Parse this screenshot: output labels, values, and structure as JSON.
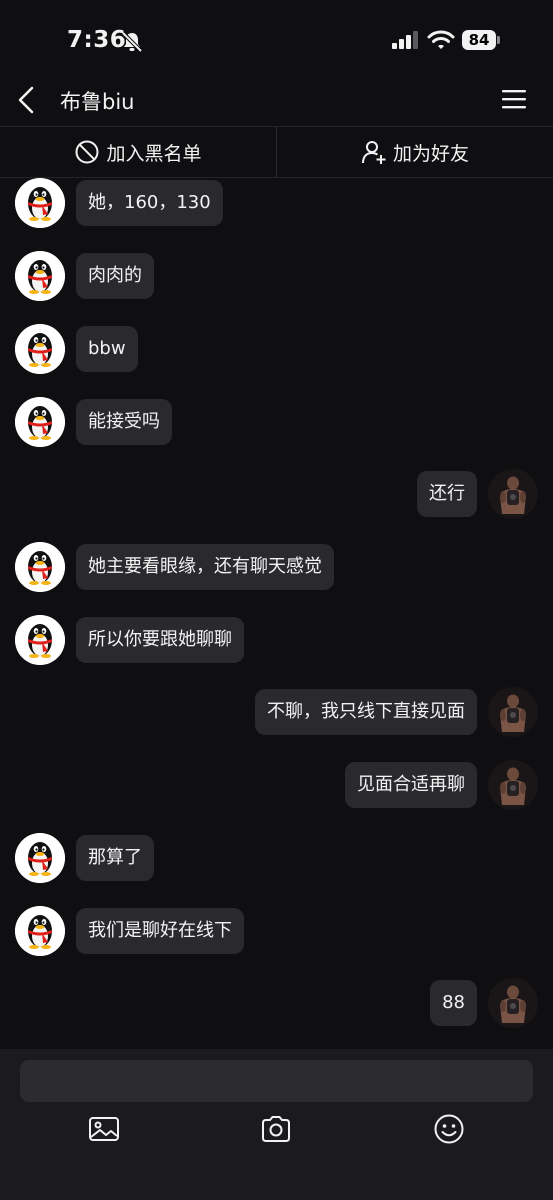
{
  "status_bar": {
    "time": "7:36",
    "battery": "84"
  },
  "header": {
    "title": "布鲁biu"
  },
  "actions": {
    "block_label": "加入黑名单",
    "add_friend_label": "加为好友"
  },
  "messages": [
    {
      "side": "left",
      "text": "她，160，130"
    },
    {
      "side": "left",
      "text": "肉肉的"
    },
    {
      "side": "left",
      "text": "bbw"
    },
    {
      "side": "left",
      "text": "能接受吗"
    },
    {
      "side": "right",
      "text": "还行"
    },
    {
      "side": "left",
      "text": "她主要看眼缘，还有聊天感觉"
    },
    {
      "side": "left",
      "text": "所以你要跟她聊聊"
    },
    {
      "side": "right",
      "text": "不聊，我只线下直接见面"
    },
    {
      "side": "right",
      "text": "见面合适再聊"
    },
    {
      "side": "left",
      "text": "那算了"
    },
    {
      "side": "left",
      "text": "我们是聊好在线下"
    },
    {
      "side": "right",
      "text": "88"
    }
  ],
  "icons": {
    "left_avatar": "penguin-avatar",
    "right_avatar": "user-photo-avatar",
    "toolbar": [
      "image-icon",
      "camera-icon",
      "emoji-icon"
    ]
  },
  "colors": {
    "background": "#0f0f12",
    "bubble": "#2a2a2e",
    "penguin_scarf": "#e0201b",
    "penguin_beak": "#f5b316"
  }
}
